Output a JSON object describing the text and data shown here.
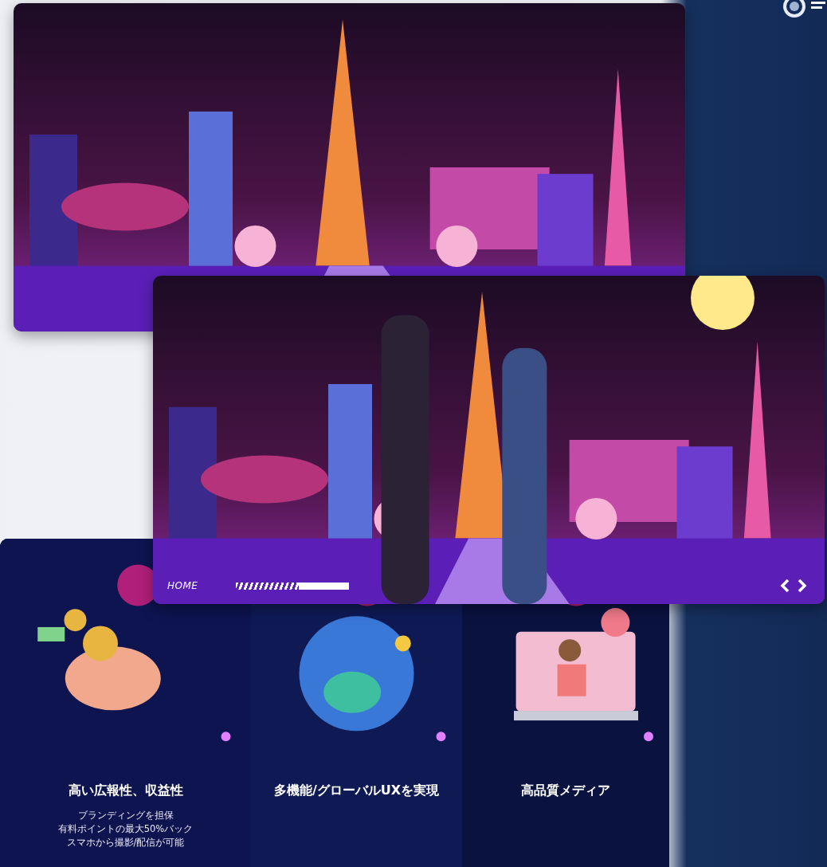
{
  "player_bar": {
    "label": "HOME",
    "level": 0.45
  },
  "features": [
    {
      "title": "高い広報性、収益性",
      "lines": [
        "ブランディングを担保",
        "有料ポイントの最大50%バック",
        "スマホから撮影/配信が可能"
      ]
    },
    {
      "title": "多機能/グローバルUXを実現"
    },
    {
      "title": "高品質メディア"
    }
  ]
}
